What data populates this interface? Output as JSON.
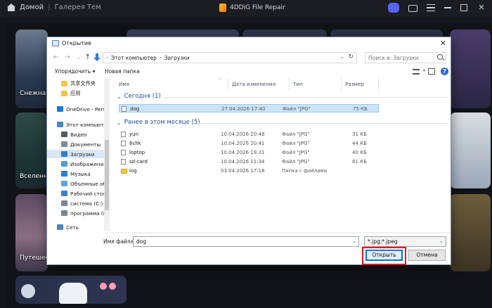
{
  "app": {
    "breadcrumb_home": "Домой",
    "breadcrumb_separator": "|",
    "breadcrumb_gallery": "Галерея Тем",
    "title": "4DDiG File Repair"
  },
  "cards": {
    "snow": "Снежная",
    "universe": "Вселенна",
    "travel": "Путешест"
  },
  "dialog": {
    "title": "Открытие",
    "close_glyph": "✕",
    "address": {
      "root": "Этот компьютер",
      "folder": "Загрузки",
      "sep": "›"
    },
    "search_placeholder": "Поиск в: Загрузки",
    "toolbar": {
      "organize": "Упорядочить ▾",
      "new_folder": "Новая папка",
      "help": "?"
    },
    "nav_items": [
      {
        "label": "共享文件夹",
        "color": "#f3c24a"
      },
      {
        "label": "应用",
        "color": "#f3c24a"
      },
      {
        "label": "OneDrive - Persona",
        "color": "#1b78d6"
      },
      {
        "label": "Этот компьютер",
        "color": "#4a86c8"
      },
      {
        "label": "Видео",
        "color": "#555b66"
      },
      {
        "label": "Документы",
        "color": "#7e8b9a"
      },
      {
        "label": "Загрузки",
        "color": "#2e7bd6"
      },
      {
        "label": "Изображения",
        "color": "#4f9fd9"
      },
      {
        "label": "Музыка",
        "color": "#2a7fd0"
      },
      {
        "label": "Объемные объ",
        "color": "#5fa3e0"
      },
      {
        "label": "Рабочий стол",
        "color": "#3a7fcc"
      },
      {
        "label": "система (C:)",
        "color": "#7a8594"
      },
      {
        "label": "программа (D",
        "color": "#7a8594"
      },
      {
        "label": "Сеть",
        "color": "#4a86c8"
      }
    ],
    "columns": {
      "name": "Имя",
      "date": "Дата изменения",
      "type": "Тип",
      "size": "Размер"
    },
    "groups": [
      {
        "title": "Сегодня (1)",
        "files": [
          {
            "name": "dog",
            "date": "27.04.2026 17:40",
            "type": "Файл \"JPG\"",
            "size": "75 КБ",
            "selected": true,
            "folder": false
          }
        ]
      },
      {
        "title": "Ранее в этом месяце (5)",
        "files": [
          {
            "name": "yun",
            "date": "10.04.2026 20:48",
            "type": "Файл \"JPG\"",
            "size": "31 КБ",
            "selected": false,
            "folder": false
          },
          {
            "name": "6chk",
            "date": "10.04.2026 20:41",
            "type": "Файл \"JPG\"",
            "size": "44 КБ",
            "selected": false,
            "folder": false
          },
          {
            "name": "loptop",
            "date": "10.04.2026 19:31",
            "type": "Файл \"JPG\"",
            "size": "40 КБ",
            "selected": false,
            "folder": false
          },
          {
            "name": "sd-card",
            "date": "10.04.2026 11:34",
            "type": "Файл \"JPG\"",
            "size": "81 КБ",
            "selected": false,
            "folder": false
          },
          {
            "name": "log",
            "date": "03.04.2026 17:18",
            "type": "Папка с файлами",
            "size": "",
            "selected": false,
            "folder": true
          }
        ]
      }
    ],
    "filename_label": "Имя файла:",
    "filename_value": "dog",
    "filter_value": "*.jpg;*.jpeg",
    "open_label": "Открыть",
    "cancel_label": "Отмена"
  }
}
